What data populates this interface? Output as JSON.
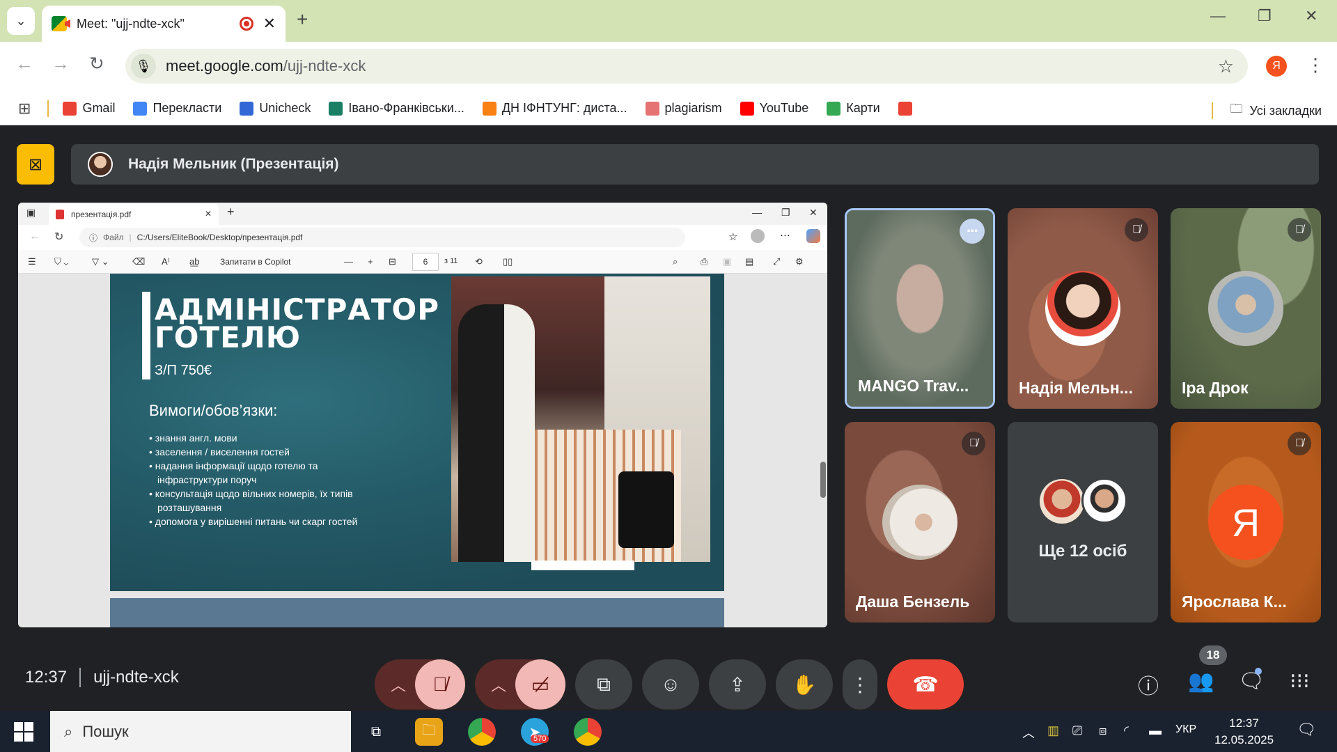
{
  "browser": {
    "tab_title": "Meet: \"ujj-ndte-xck\"",
    "url_domain": "meet.google.com",
    "url_path": "/ujj-ndte-xck",
    "profile_initial": "Я",
    "bookmarks": [
      {
        "label": "Gmail",
        "icon": "gmail-icon",
        "color": "#ea4335"
      },
      {
        "label": "Перекласти",
        "icon": "translate-icon",
        "color": "#4285f4"
      },
      {
        "label": "Unicheck",
        "icon": "unicheck-icon",
        "color": "#3367d6"
      },
      {
        "label": "Івано-Франківськи...",
        "icon": "doc-icon",
        "color": "#1a7f64"
      },
      {
        "label": "ДН ІФНТУНГ: диста...",
        "icon": "moodle-icon",
        "color": "#f98012"
      },
      {
        "label": "plagiarism",
        "icon": "page-icon",
        "color": "#e57373"
      },
      {
        "label": "YouTube",
        "icon": "youtube-icon",
        "color": "#ff0000"
      },
      {
        "label": "Карти",
        "icon": "maps-icon",
        "color": "#34a853"
      },
      {
        "label": "",
        "icon": "gmail-icon",
        "color": "#ea4335"
      }
    ],
    "all_bookmarks": "Усі закладки"
  },
  "meet": {
    "presenter": "Надія Мельник (Презентація)",
    "meeting_time": "12:37",
    "meeting_code": "ujj-ndte-xck",
    "people_count": "18",
    "shared_window": {
      "tab_title": "презентація.pdf",
      "file_label": "Файл",
      "file_path": "C:/Users/EliteBook/Desktop/презентація.pdf",
      "copilot": "Запитати в Copilot",
      "page_number": "6",
      "page_total": "з 11",
      "slide": {
        "title_line1": "АДМІНІСТРАТОР",
        "title_line2": "ГОТЕЛЮ",
        "salary": "З/П 750€",
        "requirements_heading": "Вимоги/обов’язки:",
        "requirements": [
          "знання англ. мови",
          "заселення / виселення гостей",
          "надання інформації щодо готелю та інфраструктури поруч",
          "консультація щодо вільних номерів, їх типів розташування",
          "допомога у вирішенні питань чи скарг гостей"
        ]
      }
    },
    "participants": [
      {
        "name": "MANGO Trav...",
        "muted": false,
        "active": true,
        "bg": "#6d7a6c"
      },
      {
        "name": "Надія Мельн...",
        "muted": true,
        "active": false,
        "bg": "#8f5a48"
      },
      {
        "name": "Іра Дрок",
        "muted": true,
        "active": false,
        "bg": "#5c6a4a"
      },
      {
        "name": "Даша Бензель",
        "muted": true,
        "active": false,
        "bg": "#7a4a3c"
      },
      {
        "name": "Ще 12 осіб",
        "muted": false,
        "active": false,
        "bg": "#3c4043"
      },
      {
        "name": "Ярослава К...",
        "muted": true,
        "active": false,
        "bg": "#b55a1c",
        "initial": "Я",
        "avatar_color": "#f4511e"
      }
    ]
  },
  "taskbar": {
    "search_placeholder": "Пошук",
    "telegram_badge": "570",
    "language": "УКР",
    "time": "12:37",
    "date": "12.05.2025"
  }
}
